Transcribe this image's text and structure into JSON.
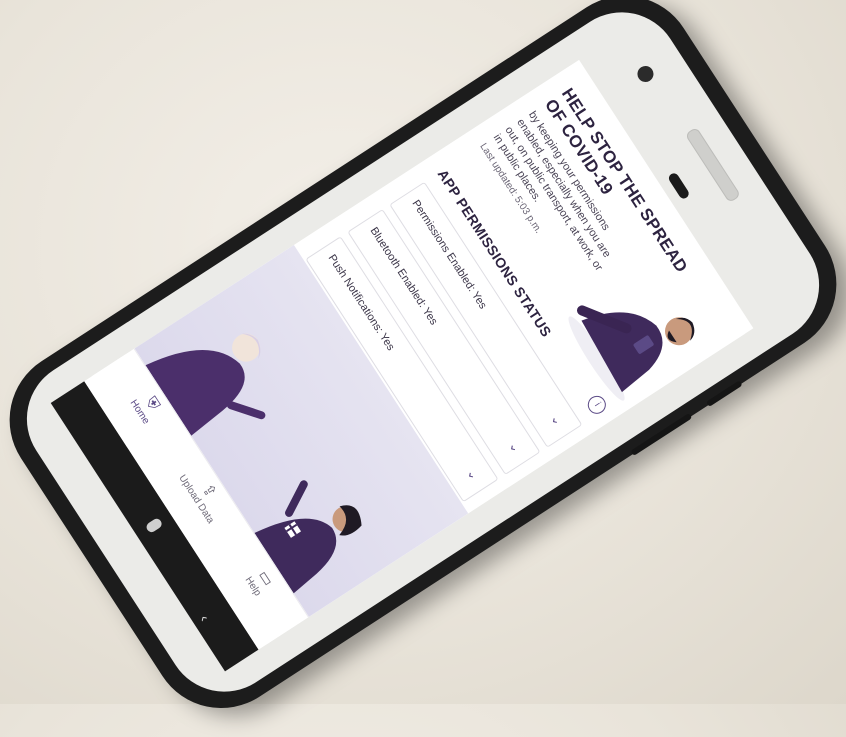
{
  "app": {
    "hero": {
      "title": "HELP STOP THE SPREAD OF COVID-19",
      "body": "by keeping your permissions enabled, especially when you are out, on public transport, at work, or in public places.",
      "updated": "Last updated: 5:03 p.m."
    },
    "permissions": {
      "title": "APP PERMISSIONS STATUS",
      "items": [
        {
          "label": "Permissions Enabled: Yes"
        },
        {
          "label": "Bluetooth Enabled: Yes"
        },
        {
          "label": "Push Notifications: Yes"
        }
      ]
    },
    "tabs": [
      {
        "label": "Home",
        "icon": "shield-icon"
      },
      {
        "label": "Upload Data",
        "icon": "upload-icon"
      },
      {
        "label": "Help",
        "icon": "chat-icon"
      }
    ]
  },
  "colors": {
    "accent": "#5b4a86",
    "heading": "#2d2340",
    "case": "#1c1c1c",
    "banner": "#dcd9ec"
  }
}
